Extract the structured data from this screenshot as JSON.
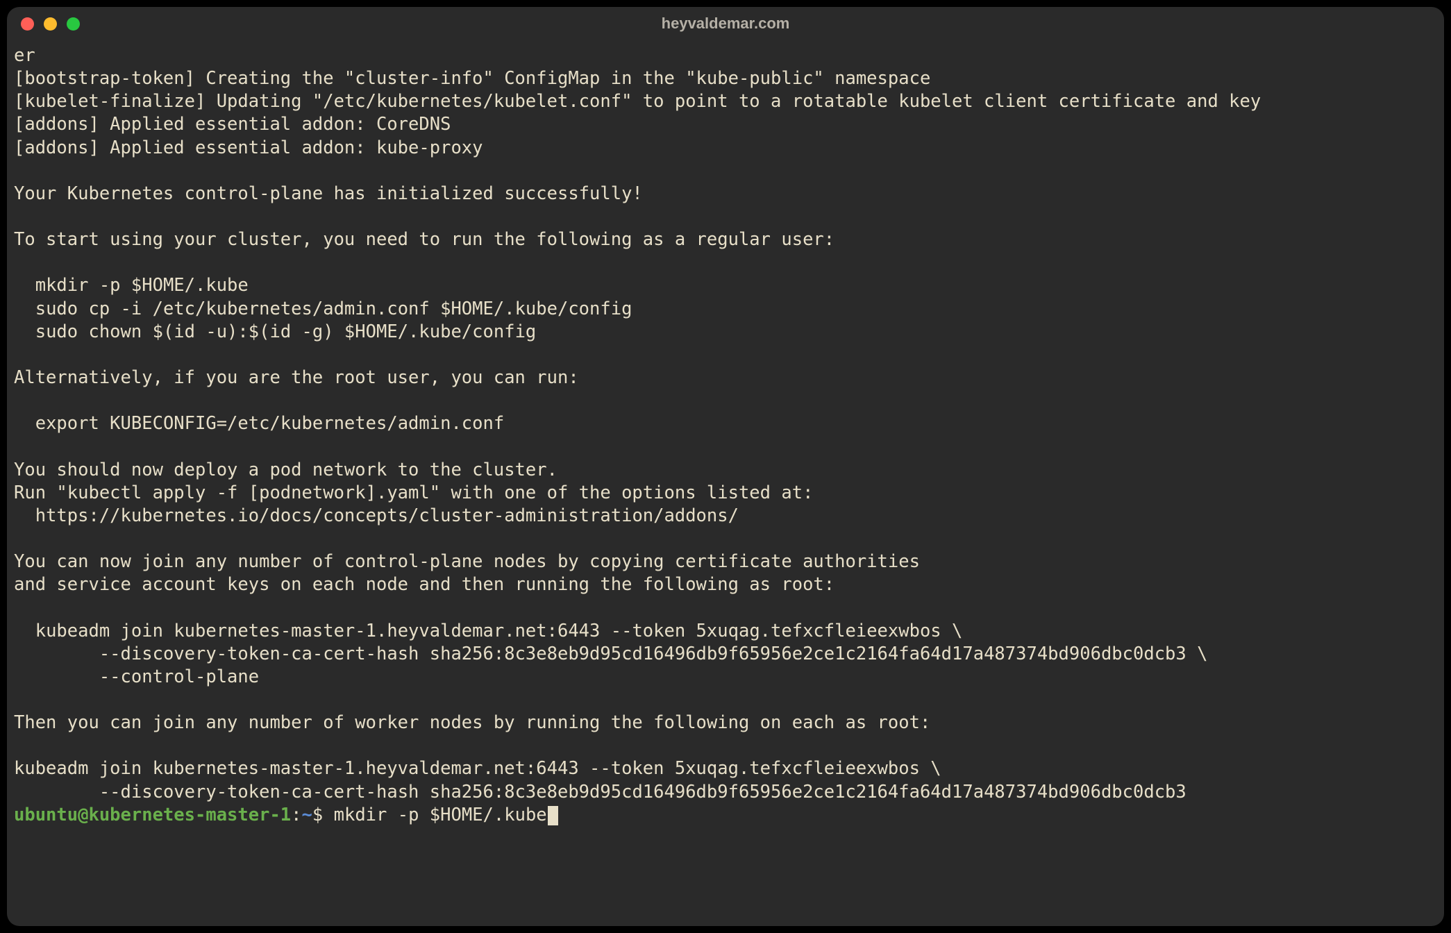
{
  "window": {
    "title": "heyvaldemar.com"
  },
  "terminal": {
    "output": "er\n[bootstrap-token] Creating the \"cluster-info\" ConfigMap in the \"kube-public\" namespace\n[kubelet-finalize] Updating \"/etc/kubernetes/kubelet.conf\" to point to a rotatable kubelet client certificate and key\n[addons] Applied essential addon: CoreDNS\n[addons] Applied essential addon: kube-proxy\n\nYour Kubernetes control-plane has initialized successfully!\n\nTo start using your cluster, you need to run the following as a regular user:\n\n  mkdir -p $HOME/.kube\n  sudo cp -i /etc/kubernetes/admin.conf $HOME/.kube/config\n  sudo chown $(id -u):$(id -g) $HOME/.kube/config\n\nAlternatively, if you are the root user, you can run:\n\n  export KUBECONFIG=/etc/kubernetes/admin.conf\n\nYou should now deploy a pod network to the cluster.\nRun \"kubectl apply -f [podnetwork].yaml\" with one of the options listed at:\n  https://kubernetes.io/docs/concepts/cluster-administration/addons/\n\nYou can now join any number of control-plane nodes by copying certificate authorities\nand service account keys on each node and then running the following as root:\n\n  kubeadm join kubernetes-master-1.heyvaldemar.net:6443 --token 5xuqag.tefxcfleieexwbos \\\n        --discovery-token-ca-cert-hash sha256:8c3e8eb9d95cd16496db9f65956e2ce1c2164fa64d17a487374bd906dbc0dcb3 \\\n        --control-plane\n\nThen you can join any number of worker nodes by running the following on each as root:\n\nkubeadm join kubernetes-master-1.heyvaldemar.net:6443 --token 5xuqag.tefxcfleieexwbos \\\n        --discovery-token-ca-cert-hash sha256:8c3e8eb9d95cd16496db9f65956e2ce1c2164fa64d17a487374bd906dbc0dcb3",
    "prompt": {
      "user_host": "ubuntu@kubernetes-master-1",
      "sep1": ":",
      "path": "~",
      "sep2": "$ ",
      "command": "mkdir -p $HOME/.kube"
    }
  },
  "colors": {
    "window_bg": "#2a2a2a",
    "text": "#e7dfc8",
    "prompt_user": "#6ab04c",
    "prompt_path": "#5b8cd6",
    "traffic_close": "#ff5f57",
    "traffic_min": "#febc2e",
    "traffic_zoom": "#28c840"
  }
}
